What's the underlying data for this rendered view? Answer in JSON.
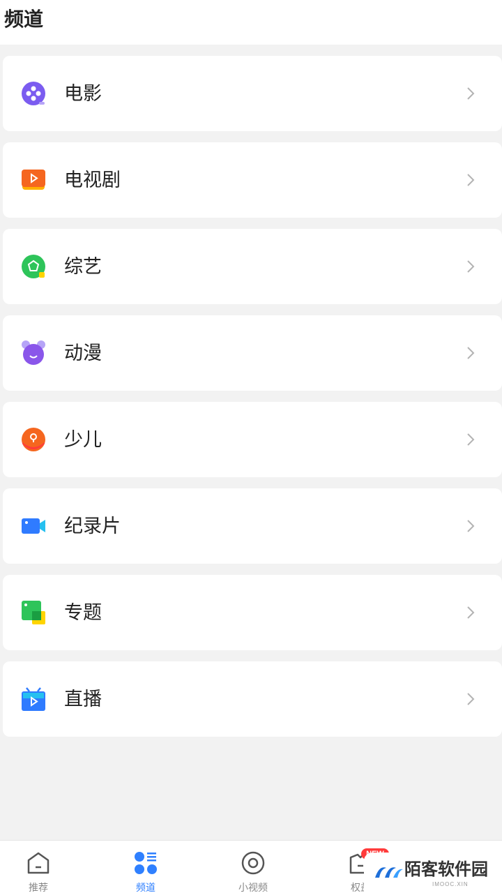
{
  "header": {
    "title": "频道"
  },
  "channels": [
    {
      "label": "电影",
      "icon": "film-reel-icon",
      "color": "#7b5cf0"
    },
    {
      "label": "电视剧",
      "icon": "tv-play-icon",
      "color": "#f5661f"
    },
    {
      "label": "综艺",
      "icon": "variety-pentagon-icon",
      "color": "#2ec45a"
    },
    {
      "label": "动漫",
      "icon": "anime-bear-icon",
      "color": "#8a56ea"
    },
    {
      "label": "少儿",
      "icon": "kids-icon",
      "color": "#f5661f"
    },
    {
      "label": "纪录片",
      "icon": "video-camera-icon",
      "color": "#2f7bff"
    },
    {
      "label": "专题",
      "icon": "topic-squares-icon",
      "color": "#2ec45a"
    },
    {
      "label": "直播",
      "icon": "live-tv-icon",
      "color": "#2f7bff"
    }
  ],
  "bottom_nav": [
    {
      "label": "推荐",
      "icon": "home-icon",
      "active": false
    },
    {
      "label": "频道",
      "icon": "channels-grid-icon",
      "active": true
    },
    {
      "label": "小视频",
      "icon": "eye-circle-icon",
      "active": false
    },
    {
      "label": "权益",
      "icon": "membership-icon",
      "active": false
    }
  ],
  "badge": {
    "text": "NEW"
  },
  "watermark": {
    "name": "陌客软件园",
    "sub": "IMOOC.XIN"
  },
  "colors": {
    "accent": "#2f80ff",
    "background": "#f2f2f2",
    "text": "#222222"
  }
}
